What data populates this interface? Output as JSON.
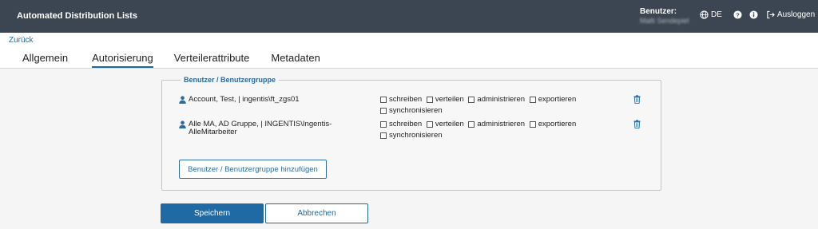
{
  "header": {
    "title": "Automated Distribution Lists",
    "user_label": "Benutzer:",
    "user_name": "Malti Sendepiel",
    "language": "DE",
    "logout_label": "Ausloggen"
  },
  "nav": {
    "back_label": "Zurück",
    "tabs": [
      {
        "label": "Allgemein",
        "active": false
      },
      {
        "label": "Autorisierung",
        "active": true
      },
      {
        "label": "Verteilerattribute",
        "active": false
      },
      {
        "label": "Metadaten",
        "active": false
      }
    ]
  },
  "permissions": {
    "legend": "Benutzer / Benutzergruppe",
    "rows": [
      {
        "name": "Account, Test, | ingentis\\ft_zgs01",
        "options": [
          "schreiben",
          "verteilen",
          "administrieren",
          "exportieren",
          "synchronisieren"
        ]
      },
      {
        "name": "Alle MA, AD Gruppe, | INGENTIS\\Ingentis-AlleMitarbeiter",
        "options": [
          "schreiben",
          "verteilen",
          "administrieren",
          "exportieren",
          "synchronisieren"
        ]
      }
    ],
    "add_button_label": "Benutzer / Benutzergruppe hinzufügen"
  },
  "actions": {
    "save_label": "Speichern",
    "cancel_label": "Abbrechen"
  },
  "colors": {
    "topbar": "#3b4652",
    "accent": "#1f6aa5",
    "link": "#2a6ca3"
  },
  "icons": [
    "globe-icon",
    "help-icon",
    "info-icon",
    "logout-icon",
    "user-icon",
    "trash-icon"
  ]
}
